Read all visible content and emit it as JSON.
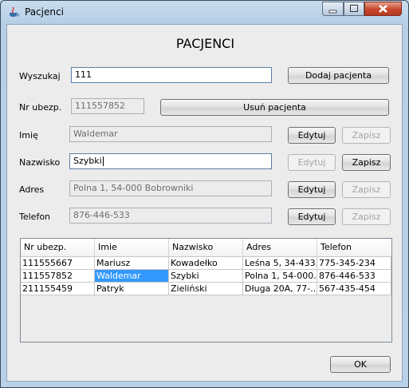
{
  "window": {
    "title": "Pacjenci"
  },
  "heading": "PACJENCI",
  "search": {
    "label": "Wyszukaj",
    "value": "111",
    "add_button": "Dodaj pacjenta"
  },
  "insurance": {
    "label": "Nr ubezp.",
    "value": "111557852",
    "remove_button": "Usuń pacjenta"
  },
  "fields": [
    {
      "label": "Imię",
      "value": "Waldemar",
      "edit": "Edytuj",
      "save": "Zapisz"
    },
    {
      "label": "Nazwisko",
      "value": "Szybki",
      "edit": "Edytuj",
      "save": "Zapisz"
    },
    {
      "label": "Adres",
      "value": "Polna 1, 54-000 Bobrowniki",
      "edit": "Edytuj",
      "save": "Zapisz"
    },
    {
      "label": "Telefon",
      "value": "876-446-533",
      "edit": "Edytuj",
      "save": "Zapisz"
    }
  ],
  "table": {
    "columns": [
      "Nr ubezp.",
      "Imie",
      "Nazwisko",
      "Adres",
      "Telefon"
    ],
    "rows": [
      [
        "111555667",
        "Mariusz",
        "Kowadełko",
        "Leśna 5, 34-433...",
        "775-345-234"
      ],
      [
        "111557852",
        "Waldemar",
        "Szybki",
        "Polna 1, 54-000...",
        "876-446-533"
      ],
      [
        "211155459",
        "Patryk",
        "Zieliński",
        "Długa 20A, 77-...",
        "567-435-454"
      ]
    ]
  },
  "ok_button": "OK",
  "colors": {
    "selection": "#3399ff",
    "window_frame": "#b9d1e8",
    "close_button": "#c8452b"
  }
}
